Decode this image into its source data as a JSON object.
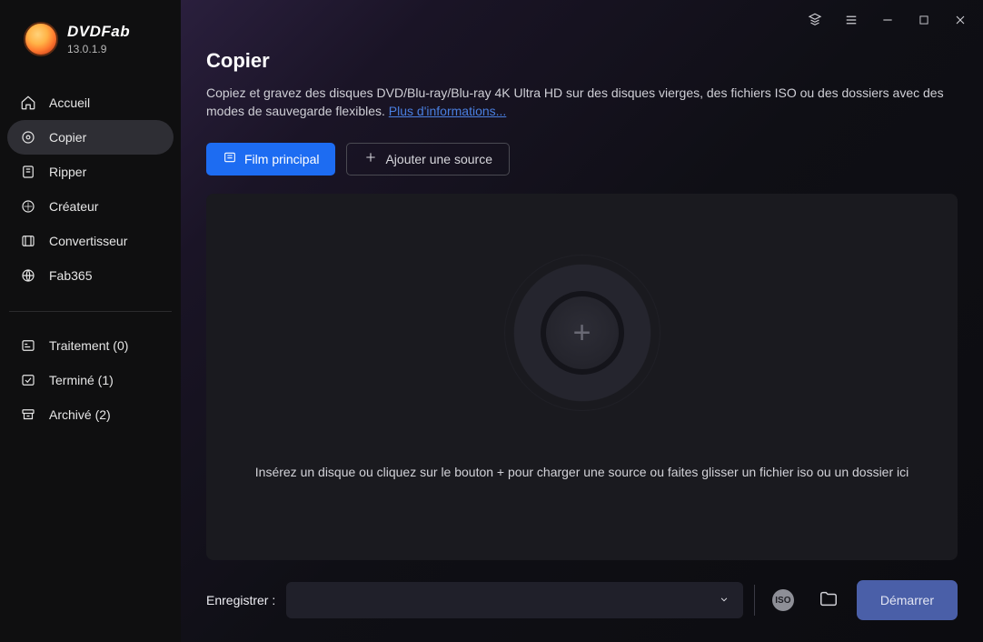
{
  "brand": {
    "name": "DVDFab",
    "version": "13.0.1.9"
  },
  "sidebar": {
    "items": [
      {
        "label": "Accueil",
        "icon": "home-icon"
      },
      {
        "label": "Copier",
        "icon": "disc-icon"
      },
      {
        "label": "Ripper",
        "icon": "rip-icon"
      },
      {
        "label": "Créateur",
        "icon": "creator-icon"
      },
      {
        "label": "Convertisseur",
        "icon": "converter-icon"
      },
      {
        "label": "Fab365",
        "icon": "globe-icon"
      }
    ],
    "status": [
      {
        "label": "Traitement (0)",
        "icon": "progress-icon"
      },
      {
        "label": "Terminé (1)",
        "icon": "done-icon"
      },
      {
        "label": "Archivé (2)",
        "icon": "archive-icon"
      }
    ]
  },
  "page": {
    "title": "Copier",
    "description": "Copiez et gravez des disques DVD/Blu-ray/Blu-ray 4K Ultra HD sur des disques vierges, des fichiers ISO ou des dossiers avec des modes de sauvegarde flexibles. ",
    "more_link": "Plus d'informations...",
    "main_movie_btn": "Film principal",
    "add_source_btn": "Ajouter une source",
    "drop_hint": "Insérez un disque ou cliquez sur le bouton +  pour charger une source ou faites glisser un fichier iso ou un dossier ici"
  },
  "footer": {
    "save_label": "Enregistrer :",
    "select_value": "",
    "iso_badge": "ISO",
    "start_btn": "Démarrer"
  }
}
